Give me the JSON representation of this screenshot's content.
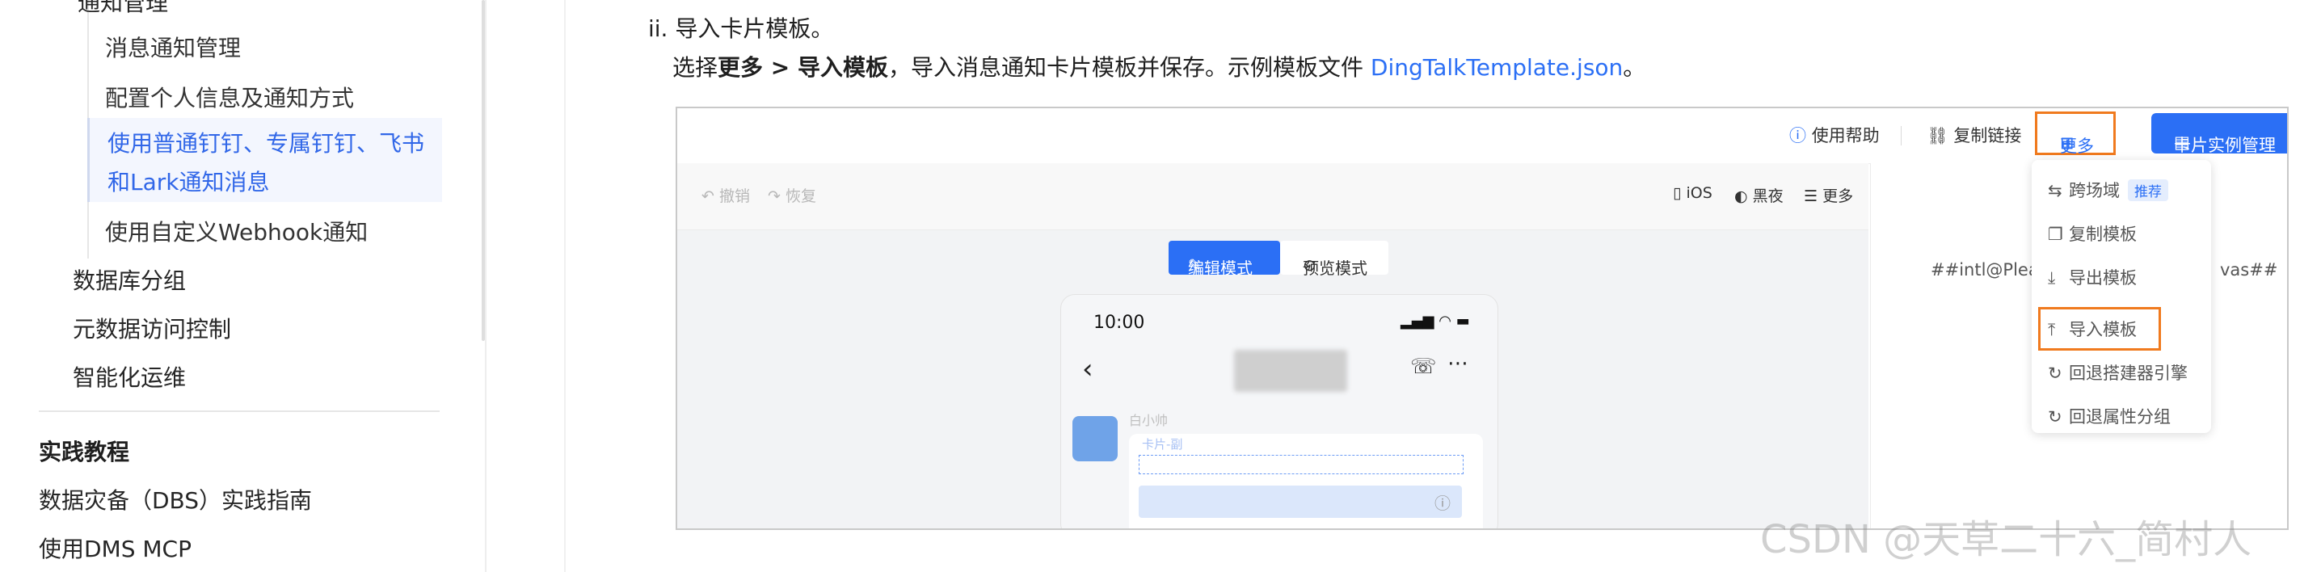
{
  "sidebar": {
    "partial_top": "通知管理",
    "sub_items": [
      {
        "label": "消息通知管理"
      },
      {
        "label": "配置个人信息及通知方式"
      },
      {
        "label_line1": "使用普通钉钉、专属钉钉、飞书",
        "label_line2": "和Lark通知消息"
      },
      {
        "label": "使用自定义Webhook通知"
      }
    ],
    "items": [
      {
        "label": "数据库分组"
      },
      {
        "label": "元数据访问控制"
      },
      {
        "label": "智能化运维"
      }
    ],
    "section_title": "实践教程",
    "section_items": [
      {
        "label": "数据灾备（DBS）实践指南"
      },
      {
        "label": "使用DMS MCP"
      }
    ]
  },
  "main": {
    "step_text": "ii. 导入卡片模板。",
    "desc_prefix": "选择",
    "desc_bold": "更多 > 导入模板",
    "desc_middle": "，导入消息通知卡片模板并保存。示例模板文件 ",
    "desc_link": "DingTalkTemplate.json",
    "desc_suffix": "。"
  },
  "screenshot": {
    "topbar": {
      "help": "使用帮助",
      "copy_link": "复制链接",
      "more": "更多",
      "card_manage": "卡片实例管理"
    },
    "editor": {
      "undo": "撤销",
      "redo": "恢复",
      "ios": "iOS",
      "dark": "黑夜",
      "more": "更多",
      "mode_edit": "编辑模式",
      "mode_preview": "预览模式",
      "phone_time": "10:00",
      "sender": "白小帅",
      "card_label": "卡片-副"
    },
    "right_panel_text_left": "##intl@Pleas",
    "right_panel_text_right": "vas##",
    "menu": [
      {
        "label": "跨场域",
        "tag": "推荐",
        "icon": "switch-icon"
      },
      {
        "label": "复制模板",
        "icon": "copy-icon"
      },
      {
        "label": "导出模板",
        "icon": "download-icon"
      },
      {
        "label": "导入模板",
        "icon": "upload-icon"
      },
      {
        "label": "回退搭建器引擎",
        "icon": "rollback-icon"
      },
      {
        "label": "回退属性分组",
        "icon": "rollback-icon"
      }
    ]
  },
  "watermark": "CSDN @天草二十六_简村人",
  "colors": {
    "accent": "#2b6ff5",
    "highlight": "#f07a1e"
  }
}
